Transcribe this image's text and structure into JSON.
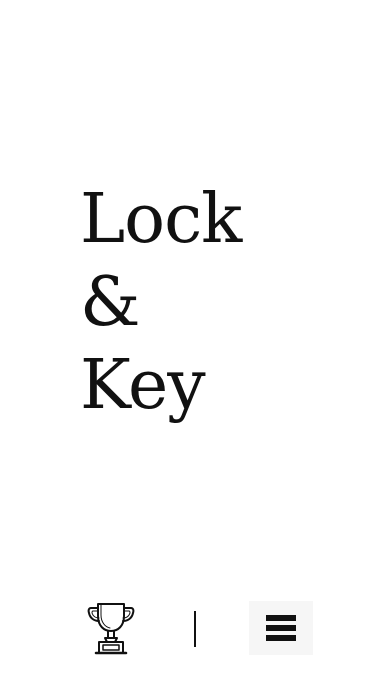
{
  "app": {
    "title_lines": [
      "Lock",
      "&",
      "Key"
    ]
  },
  "bottom_bar": {
    "trophy_icon": "trophy-icon",
    "menu_icon": "hamburger-menu-icon"
  },
  "colors": {
    "background": "#ffffff",
    "text": "#111111",
    "menu_button_bg": "#f6f6f6"
  }
}
